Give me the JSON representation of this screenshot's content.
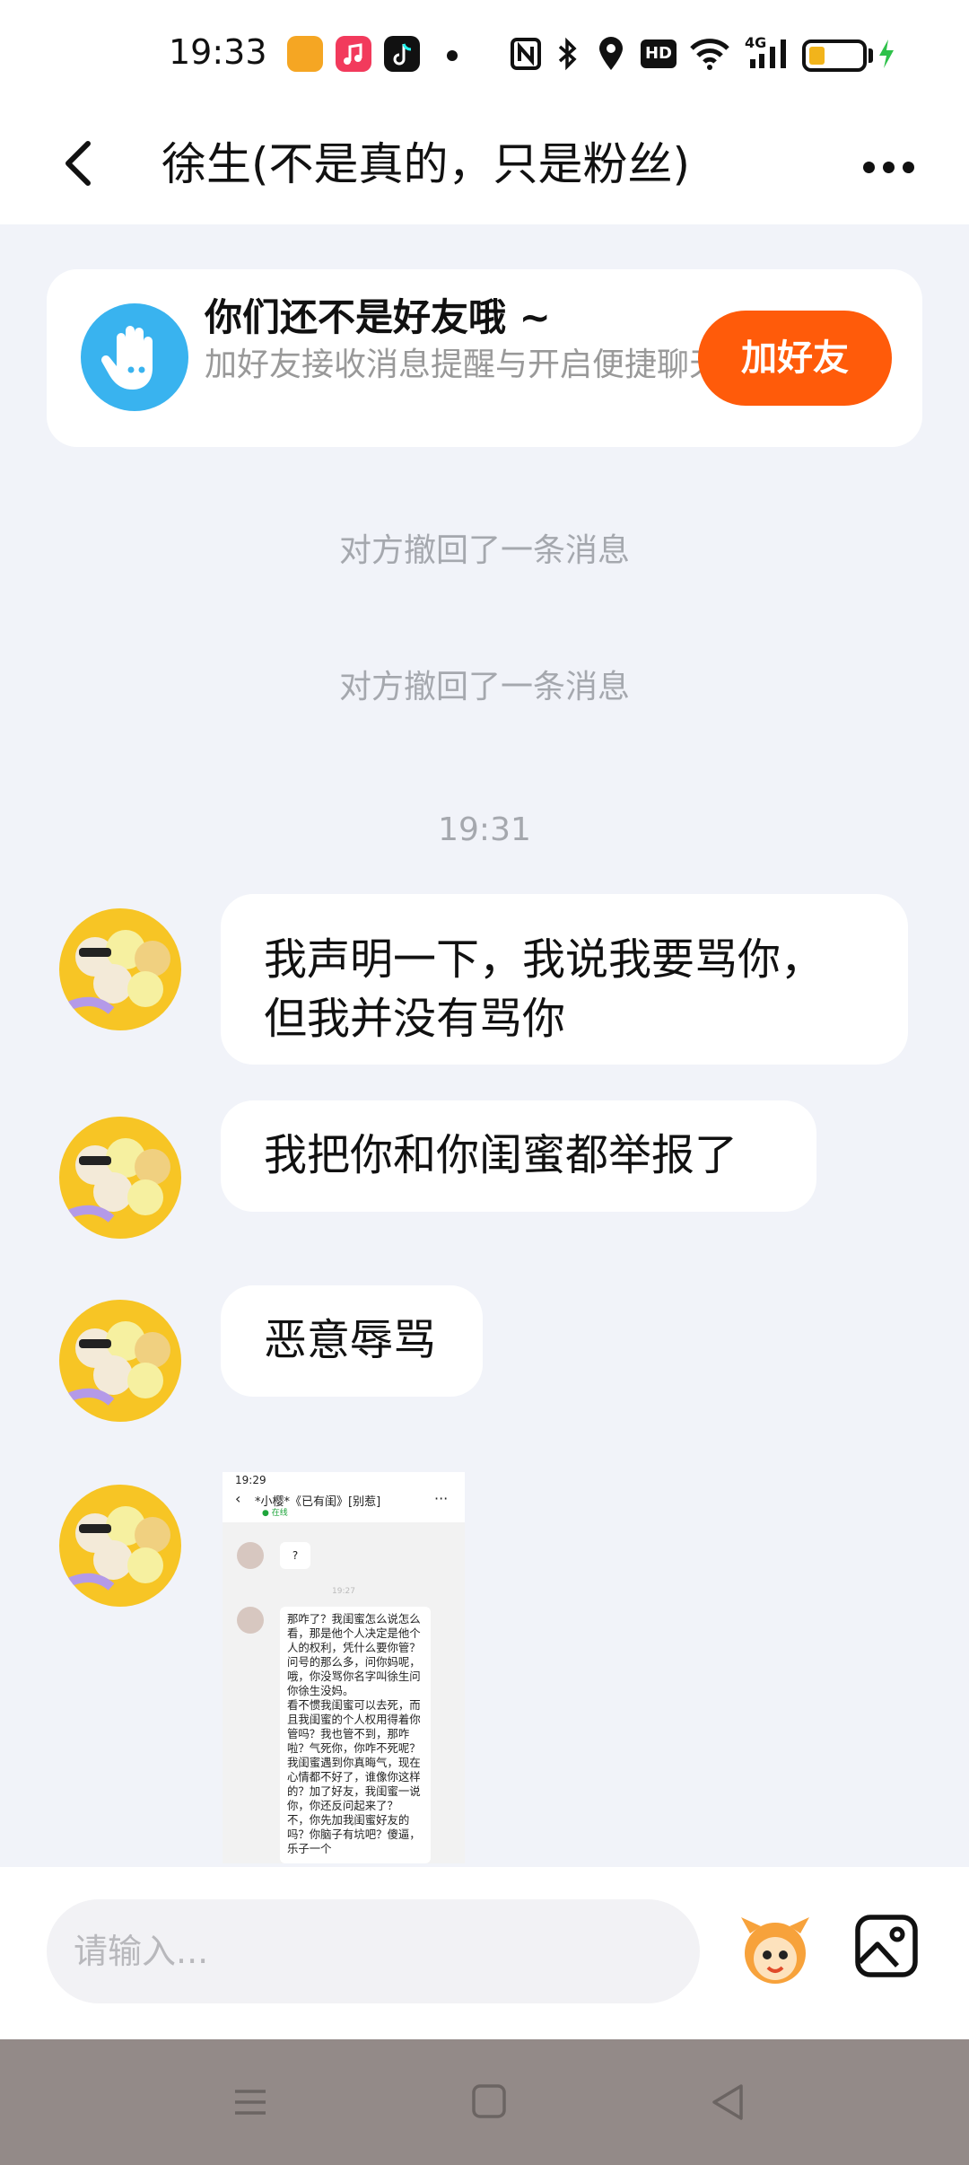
{
  "status_bar": {
    "time": "19:33",
    "icons": [
      "app-badge-icon",
      "music-icon",
      "tiktok-icon",
      "dot-icon",
      "nfc-icon",
      "bluetooth-icon",
      "location-icon",
      "hd-icon",
      "wifi-icon",
      "signal-4g-icon",
      "battery-icon",
      "charging-icon"
    ],
    "hd_label": "HD",
    "network_label": "4G",
    "battery_level": 0.26
  },
  "header": {
    "title": "徐生(不是真的，只是粉丝)"
  },
  "banner": {
    "title": "你们还不是好友哦 ~",
    "description": "加好友接收消息提醒与开启便捷聊天",
    "button_label": "加好友"
  },
  "system_notes": [
    "对方撤回了一条消息",
    "对方撤回了一条消息"
  ],
  "timestamp": "19:31",
  "messages": [
    {
      "text": "我声明一下，我说我要骂你，但我并没有骂你"
    },
    {
      "text": "我把你和你闺蜜都举报了"
    },
    {
      "text": "恶意辱骂"
    }
  ],
  "screenshot_message": {
    "time": "19:29",
    "title": "*小樱*《已有闺》[别惹]",
    "status": "● 在线",
    "question": "?",
    "inner_time": "19:27",
    "long_text": "那咋了？我闺蜜怎么说怎么看，那是他个人决定是他个人的权利，凭什么要你管？问号的那么多，问你妈呢，哦，你没骂你名字叫徐生问你徐生没妈。\n看不惯我闺蜜可以去死，而且我闺蜜的个人权用得着你管吗？我也管不到，那咋啦？气死你，你咋不死呢？\n我闺蜜遇到你真晦气，现在心情都不好了，谁像你这样的？加了好友，我闺蜜一说你，你还反问起来了？\n不，你先加我闺蜜好友的吗？你脑子有坑吧？傻逼，乐子一个"
  },
  "input_bar": {
    "placeholder": "请输入..."
  },
  "colors": {
    "accent": "#ff5b0a",
    "chat_background": "#f1f3f9",
    "nav_bar": "#938a88"
  }
}
